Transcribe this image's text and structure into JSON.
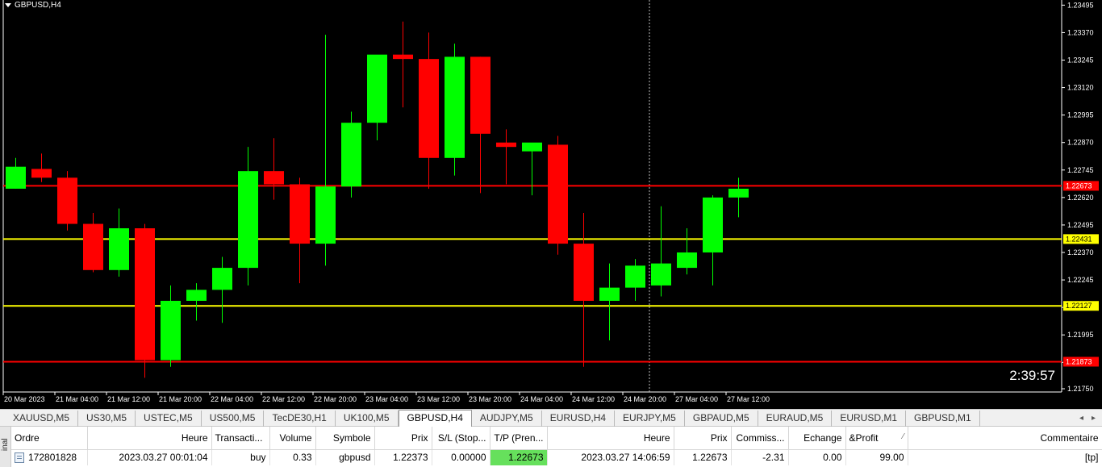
{
  "chart": {
    "title": "GBPUSD,H4",
    "timer": "2:39:57",
    "colors": {
      "bull": "#00ff00",
      "bear": "#ff0000",
      "background": "#000000",
      "axis_text": "#ffffff",
      "tp_line": "#ff0000",
      "sl_line": "#ffff00"
    }
  },
  "chart_data": {
    "type": "candlestick",
    "symbol": "GBPUSD",
    "timeframe": "H4",
    "ylim": [
      1.2175,
      1.235
    ],
    "y_ticks": [
      "1.23495",
      "1.23370",
      "1.23245",
      "1.23120",
      "1.22995",
      "1.22870",
      "1.22745",
      "1.22620",
      "1.22495",
      "1.22370",
      "1.22245",
      "1.22120",
      "1.21995",
      "1.21870",
      "1.21750"
    ],
    "x_labels": [
      "20 Mar 2023",
      "21 Mar 04:00",
      "21 Mar 12:00",
      "21 Mar 20:00",
      "22 Mar 04:00",
      "22 Mar 12:00",
      "22 Mar 20:00",
      "23 Mar 04:00",
      "23 Mar 12:00",
      "23 Mar 20:00",
      "24 Mar 04:00",
      "24 Mar 12:00",
      "24 Mar 20:00",
      "27 Mar 04:00",
      "27 Mar 12:00"
    ],
    "candles": [
      {
        "o": 1.2266,
        "h": 1.228,
        "l": 1.2266,
        "c": 1.2276
      },
      {
        "o": 1.2275,
        "h": 1.2282,
        "l": 1.2269,
        "c": 1.2271
      },
      {
        "o": 1.2271,
        "h": 1.2274,
        "l": 1.2247,
        "c": 1.225
      },
      {
        "o": 1.225,
        "h": 1.2255,
        "l": 1.2228,
        "c": 1.2229
      },
      {
        "o": 1.2229,
        "h": 1.2257,
        "l": 1.2226,
        "c": 1.2248
      },
      {
        "o": 1.2248,
        "h": 1.225,
        "l": 1.218,
        "c": 1.2188
      },
      {
        "o": 1.2188,
        "h": 1.2222,
        "l": 1.2185,
        "c": 1.2215
      },
      {
        "o": 1.2215,
        "h": 1.2223,
        "l": 1.2206,
        "c": 1.222
      },
      {
        "o": 1.222,
        "h": 1.2235,
        "l": 1.2205,
        "c": 1.223
      },
      {
        "o": 1.223,
        "h": 1.2285,
        "l": 1.2222,
        "c": 1.2274
      },
      {
        "o": 1.2274,
        "h": 1.2289,
        "l": 1.2261,
        "c": 1.2268
      },
      {
        "o": 1.2268,
        "h": 1.2271,
        "l": 1.2223,
        "c": 1.2241
      },
      {
        "o": 1.2241,
        "h": 1.2336,
        "l": 1.2231,
        "c": 1.2267
      },
      {
        "o": 1.2267,
        "h": 1.2301,
        "l": 1.2262,
        "c": 1.2296
      },
      {
        "o": 1.2296,
        "h": 1.2323,
        "l": 1.2288,
        "c": 1.2327
      },
      {
        "o": 1.2327,
        "h": 1.2342,
        "l": 1.2303,
        "c": 1.2325
      },
      {
        "o": 1.2325,
        "h": 1.2337,
        "l": 1.2266,
        "c": 1.228
      },
      {
        "o": 1.228,
        "h": 1.2332,
        "l": 1.2272,
        "c": 1.2326
      },
      {
        "o": 1.2326,
        "h": 1.2326,
        "l": 1.2264,
        "c": 1.2291
      },
      {
        "o": 1.2287,
        "h": 1.2293,
        "l": 1.2268,
        "c": 1.2285
      },
      {
        "o": 1.2283,
        "h": 1.2286,
        "l": 1.2263,
        "c": 1.2287
      },
      {
        "o": 1.2286,
        "h": 1.229,
        "l": 1.2236,
        "c": 1.2241
      },
      {
        "o": 1.2241,
        "h": 1.2255,
        "l": 1.2185,
        "c": 1.2215
      },
      {
        "o": 1.2215,
        "h": 1.2232,
        "l": 1.2197,
        "c": 1.2221
      },
      {
        "o": 1.2221,
        "h": 1.2234,
        "l": 1.2215,
        "c": 1.2231
      },
      {
        "o": 1.2222,
        "h": 1.2258,
        "l": 1.2217,
        "c": 1.2232
      },
      {
        "o": 1.223,
        "h": 1.2248,
        "l": 1.2227,
        "c": 1.2237
      },
      {
        "o": 1.2237,
        "h": 1.2263,
        "l": 1.2222,
        "c": 1.2262
      },
      {
        "o": 1.2262,
        "h": 1.2271,
        "l": 1.2253,
        "c": 1.2266
      }
    ],
    "hlines": [
      {
        "value": 1.22673,
        "label": "1.22673",
        "color": "#ff0000"
      },
      {
        "value": 1.22431,
        "label": "1.22431",
        "color": "#ffff00"
      },
      {
        "value": 1.22127,
        "label": "1.22127",
        "color": "#ffff00"
      },
      {
        "value": 1.21873,
        "label": "1.21873",
        "color": "#ff0000"
      }
    ],
    "grid": false
  },
  "tabs": [
    {
      "label": "XAUUSD,M5",
      "active": false
    },
    {
      "label": "US30,M5",
      "active": false
    },
    {
      "label": "USTEC,M5",
      "active": false
    },
    {
      "label": "US500,M5",
      "active": false
    },
    {
      "label": "TecDE30,H1",
      "active": false
    },
    {
      "label": "UK100,M5",
      "active": false
    },
    {
      "label": "GBPUSD,H4",
      "active": true
    },
    {
      "label": "AUDJPY,M5",
      "active": false
    },
    {
      "label": "EURUSD,H4",
      "active": false
    },
    {
      "label": "EURJPY,M5",
      "active": false
    },
    {
      "label": "GBPAUD,M5",
      "active": false
    },
    {
      "label": "EURAUD,M5",
      "active": false
    },
    {
      "label": "EURUSD,M1",
      "active": false
    },
    {
      "label": "GBPUSD,M1",
      "active": false
    }
  ],
  "tab_scroll": {
    "left": "◂",
    "right": "▸"
  },
  "terminal": {
    "side_label": "inal",
    "columns": [
      "Ordre",
      "Heure",
      "Transacti...",
      "Volume",
      "Symbole",
      "Prix",
      "S/L (Stop...",
      "T/P (Pren...",
      "Heure",
      "Prix",
      "Commiss...",
      "Echange",
      "&Profit",
      "Commentaire"
    ],
    "sort_indicator": "⁄",
    "row": {
      "order": "172801828",
      "time_open": "2023.03.27 00:01:04",
      "type": "buy",
      "volume": "0.33",
      "symbol": "gbpusd",
      "price_open": "1.22373",
      "sl": "0.00000",
      "tp": "1.22673",
      "time_close": "2023.03.27 14:06:59",
      "price_close": "1.22673",
      "commission": "-2.31",
      "swap": "0.00",
      "profit": "99.00",
      "comment": "[tp]"
    }
  }
}
